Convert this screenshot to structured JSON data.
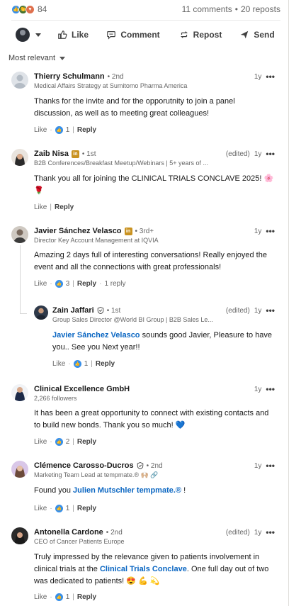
{
  "social": {
    "reaction_count": "84",
    "comments": "11 comments",
    "separator": "•",
    "reposts": "20 reposts"
  },
  "actions": {
    "like": "Like",
    "comment": "Comment",
    "repost": "Repost",
    "send": "Send"
  },
  "sort": {
    "label": "Most relevant"
  },
  "comments": [
    {
      "name": "Thierry Schulmann",
      "degree": "• 2nd",
      "headline": "Medical Affairs Strategy at Sumitomo Pharma America",
      "time": "1y",
      "more": "•••",
      "text": "Thanks for the invite and for the opporutnity to join a panel discussion, as well as to meeting great colleagues!",
      "like": "Like",
      "like_count": "1",
      "reply": "Reply"
    },
    {
      "name": "Zaib Nisa",
      "badge": "in",
      "degree": "• 1st",
      "headline": "B2B Conferences/Breakfast Meetup/Webinars | 5+ years of ...",
      "edited": "(edited)",
      "time": "1y",
      "more": "•••",
      "text": "Thank you all for joining the CLINICAL TRIALS CONCLAVE 2025! 🌸 🌹",
      "like": "Like",
      "reply": "Reply"
    },
    {
      "name": "Javier Sánchez Velasco",
      "badge": "in",
      "degree": "• 3rd+",
      "headline": "Director Key Account Management at IQVIA",
      "time": "1y",
      "more": "•••",
      "text": "Amazing 2 days full of interesting conversations! Really enjoyed the event and all the connections with great professionals!",
      "like": "Like",
      "like_count": "3",
      "reply": "Reply",
      "replies": "1 reply"
    },
    {
      "name": "Zain Jaffari",
      "degree": "• 1st",
      "headline": "Group Sales Director @World BI Group | B2B Sales Le...",
      "edited": "(edited)",
      "time": "1y",
      "more": "•••",
      "mention": "Javier Sánchez Velasco",
      "text": " sounds good Javier, Pleasure to have you.. See you Next year!!",
      "like": "Like",
      "like_count": "1",
      "reply": "Reply"
    },
    {
      "name": "Clinical Excellence GmbH",
      "headline": "2,266 followers",
      "time": "1y",
      "more": "•••",
      "text": "It has been a great opportunity to connect with existing contacts and to build new bonds. Thank you so much! 💙",
      "like": "Like",
      "like_count": "2",
      "reply": "Reply"
    },
    {
      "name": "Clémence Carosso-Ducros",
      "degree": "• 2nd",
      "headline": "Marketing Team Lead at tempmate.® 🙌🏼 🔗",
      "time": "1y",
      "more": "•••",
      "text_pre": "Found you ",
      "mention": "Julien Mutschler tempmate.®",
      "text": " !",
      "like": "Like",
      "like_count": "1",
      "reply": "Reply"
    },
    {
      "name": "Antonella Cardone",
      "degree": "• 2nd",
      "headline": "CEO of Cancer Patients Europe",
      "edited": "(edited)",
      "time": "1y",
      "more": "•••",
      "text_pre": "Truly impressed by the relevance given to patients involvement in clinical trials at the ",
      "mention": "Clinical Trials Conclave",
      "text": ". One full day out of two was dedicated to patients! 😍 💪 💫",
      "like": "Like",
      "like_count": "1",
      "reply": "Reply"
    }
  ],
  "colors": {
    "link": "#0a66c2",
    "like": "#378fe9",
    "muted": "#666666"
  }
}
